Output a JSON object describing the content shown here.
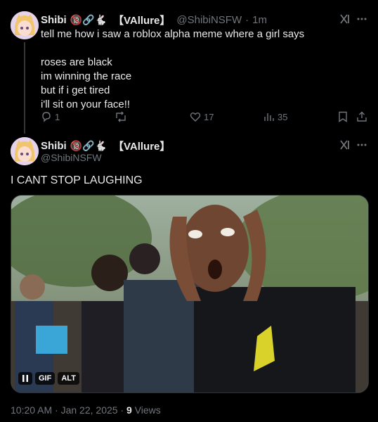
{
  "post1": {
    "name": "Shibi",
    "badge_emojis": "🔞🔗🐇",
    "affiliation": "【VAllure】",
    "handle": "@ShibiNSFW",
    "separator": "·",
    "time": "1m",
    "text": "tell me how i saw a roblox alpha meme where a girl says\n\nroses are black\nim winning the race\nbut if i get tired\ni'll sit on your face!!",
    "replies": "1",
    "likes": "17",
    "views": "35"
  },
  "post2": {
    "name": "Shibi",
    "badge_emojis": "🔞🔗🐇",
    "affiliation": "【VAllure】",
    "handle": "@ShibiNSFW",
    "text": "I CANT STOP LAUGHING",
    "media_badges": {
      "gif": "GIF",
      "alt": "ALT"
    },
    "timestamp": "10:20 AM · Jan 22, 2025",
    "dot": "·",
    "view_count": "9",
    "views_label": "Views"
  },
  "icons": {
    "grok": "grok-icon",
    "more": "more-icon",
    "reply": "reply-icon",
    "repost": "repost-icon",
    "like": "heart-icon",
    "views": "views-icon",
    "bookmark": "bookmark-icon",
    "share": "share-icon",
    "pause": "pause-icon"
  }
}
